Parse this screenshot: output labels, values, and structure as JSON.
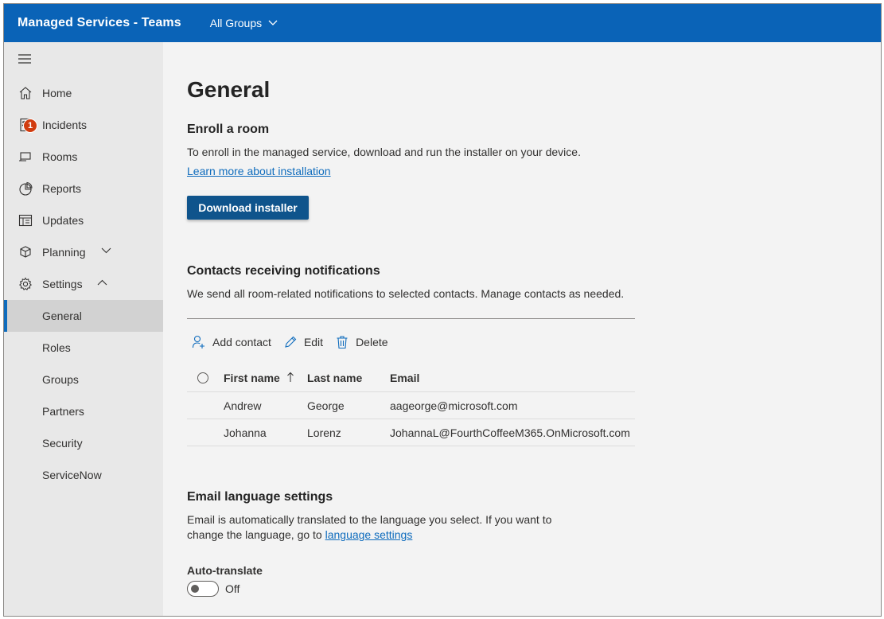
{
  "header": {
    "app_title": "Managed Services - Teams",
    "group_selector": "All Groups"
  },
  "sidebar": {
    "items": [
      {
        "label": "Home",
        "icon": "home-icon"
      },
      {
        "label": "Incidents",
        "icon": "incidents-icon",
        "badge": "1"
      },
      {
        "label": "Rooms",
        "icon": "rooms-icon"
      },
      {
        "label": "Reports",
        "icon": "reports-icon"
      },
      {
        "label": "Updates",
        "icon": "updates-icon"
      },
      {
        "label": "Planning",
        "icon": "planning-icon",
        "expanded": false
      },
      {
        "label": "Settings",
        "icon": "settings-icon",
        "expanded": true
      }
    ],
    "settings_children": [
      "General",
      "Roles",
      "Groups",
      "Partners",
      "Security",
      "ServiceNow"
    ],
    "active": "General"
  },
  "main": {
    "title": "General",
    "enroll": {
      "heading": "Enroll a room",
      "description": "To enroll in the managed service, download and run the installer on your device.",
      "link": "Learn more about installation",
      "button": "Download installer"
    },
    "contacts": {
      "heading": "Contacts receiving notifications",
      "description": "We send all room-related notifications to selected contacts. Manage contacts as needed.",
      "toolbar": {
        "add": "Add contact",
        "edit": "Edit",
        "delete": "Delete"
      },
      "columns": {
        "first": "First name",
        "last": "Last name",
        "email": "Email"
      },
      "rows": [
        {
          "first": "Andrew",
          "last": "George",
          "email": "aageorge@microsoft.com"
        },
        {
          "first": "Johanna",
          "last": "Lorenz",
          "email": "JohannaL@FourthCoffeeM365.OnMicrosoft.com"
        }
      ]
    },
    "email_language": {
      "heading": "Email language settings",
      "description_line1": "Email is automatically translated to the language you select. If you want to",
      "description_line2": "change the language, go to",
      "link": "language settings",
      "toggle_label": "Auto-translate",
      "toggle_state": "Off"
    }
  },
  "colors": {
    "header_bg": "#0a63b7",
    "primary_button": "#0f548c",
    "link": "#0f6cbd",
    "badge": "#d13c0f"
  }
}
